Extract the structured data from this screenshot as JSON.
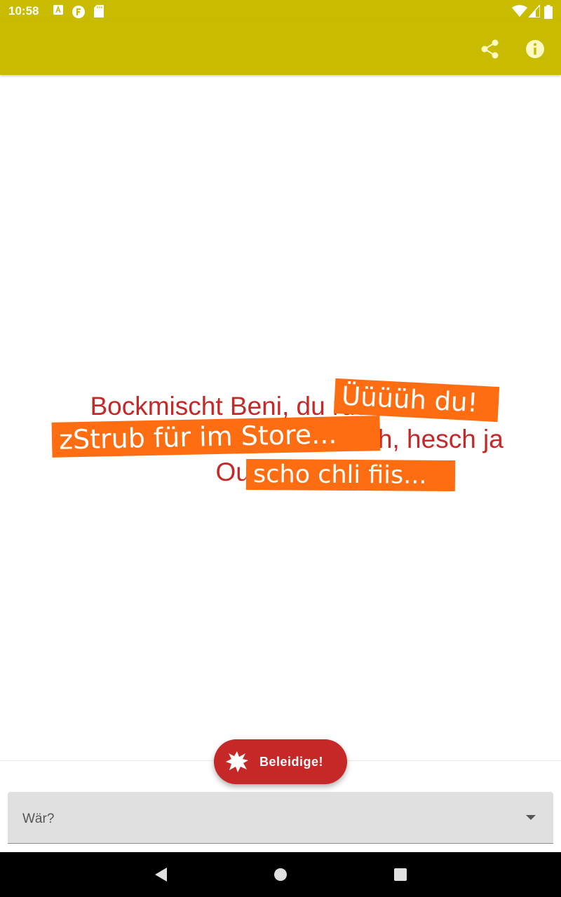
{
  "status_bar": {
    "time": "10:58",
    "icons": [
      "a-notification-icon",
      "f-notification-icon",
      "sd-card-icon",
      "wifi-icon",
      "signal-icon",
      "battery-icon"
    ]
  },
  "app_bar": {
    "color": "#c8bb00",
    "actions": [
      "share-icon",
      "info-icon"
    ]
  },
  "quote": {
    "lines": [
      "Bockmischt Beni, du ruuuuuuuue",
      "nüüüüüüüüüüüüüüüüüüüisch, hesch ja",
      "Ouge wi gs"
    ],
    "color": "#c62828"
  },
  "stickers": {
    "sticker1": "Üüüüh du!",
    "sticker2": "zStrub für im Store...",
    "sticker3": "scho chli fiis...",
    "color": "#ff6d12"
  },
  "fab": {
    "label": "Beleidige!",
    "icon": "explosion-icon",
    "color": "#c62828"
  },
  "selector": {
    "value": "Wär?",
    "icon": "dropdown-arrow-icon"
  },
  "nav_bar": {
    "icons": [
      "back-icon",
      "home-icon",
      "recents-icon"
    ]
  }
}
